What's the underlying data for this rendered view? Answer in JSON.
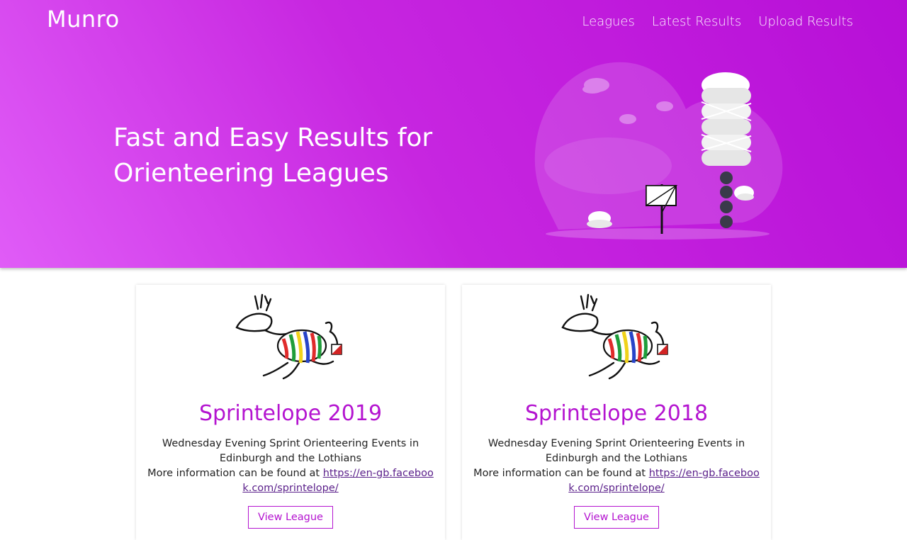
{
  "header": {
    "brand": "Munro",
    "nav": [
      {
        "label": "Leagues"
      },
      {
        "label": "Latest Results"
      },
      {
        "label": "Upload Results"
      }
    ]
  },
  "hero": {
    "headline_line1": "Fast and Easy Results for",
    "headline_line2": "Orienteering Leagues"
  },
  "leagues": [
    {
      "title": "Sprintelope 2019",
      "description": "Wednesday Evening Sprint Orienteering Events in Edinburgh and the Lothians",
      "more_info_prefix": "More information can be found at ",
      "link": "https://en-gb.facebook.com/sprintelope/",
      "button": "View League"
    },
    {
      "title": "Sprintelope 2018",
      "description": "Wednesday Evening Sprint Orienteering Events in Edinburgh and the Lothians",
      "more_info_prefix": "More information can be found at ",
      "link": "https://en-gb.facebook.com/sprintelope/",
      "button": "View League"
    }
  ],
  "colors": {
    "hero_start": "#e05cf7",
    "hero_end": "#b70fd7",
    "accent": "#b414d0"
  },
  "icons": [
    "hero-illustration",
    "sprintelope-logo"
  ]
}
